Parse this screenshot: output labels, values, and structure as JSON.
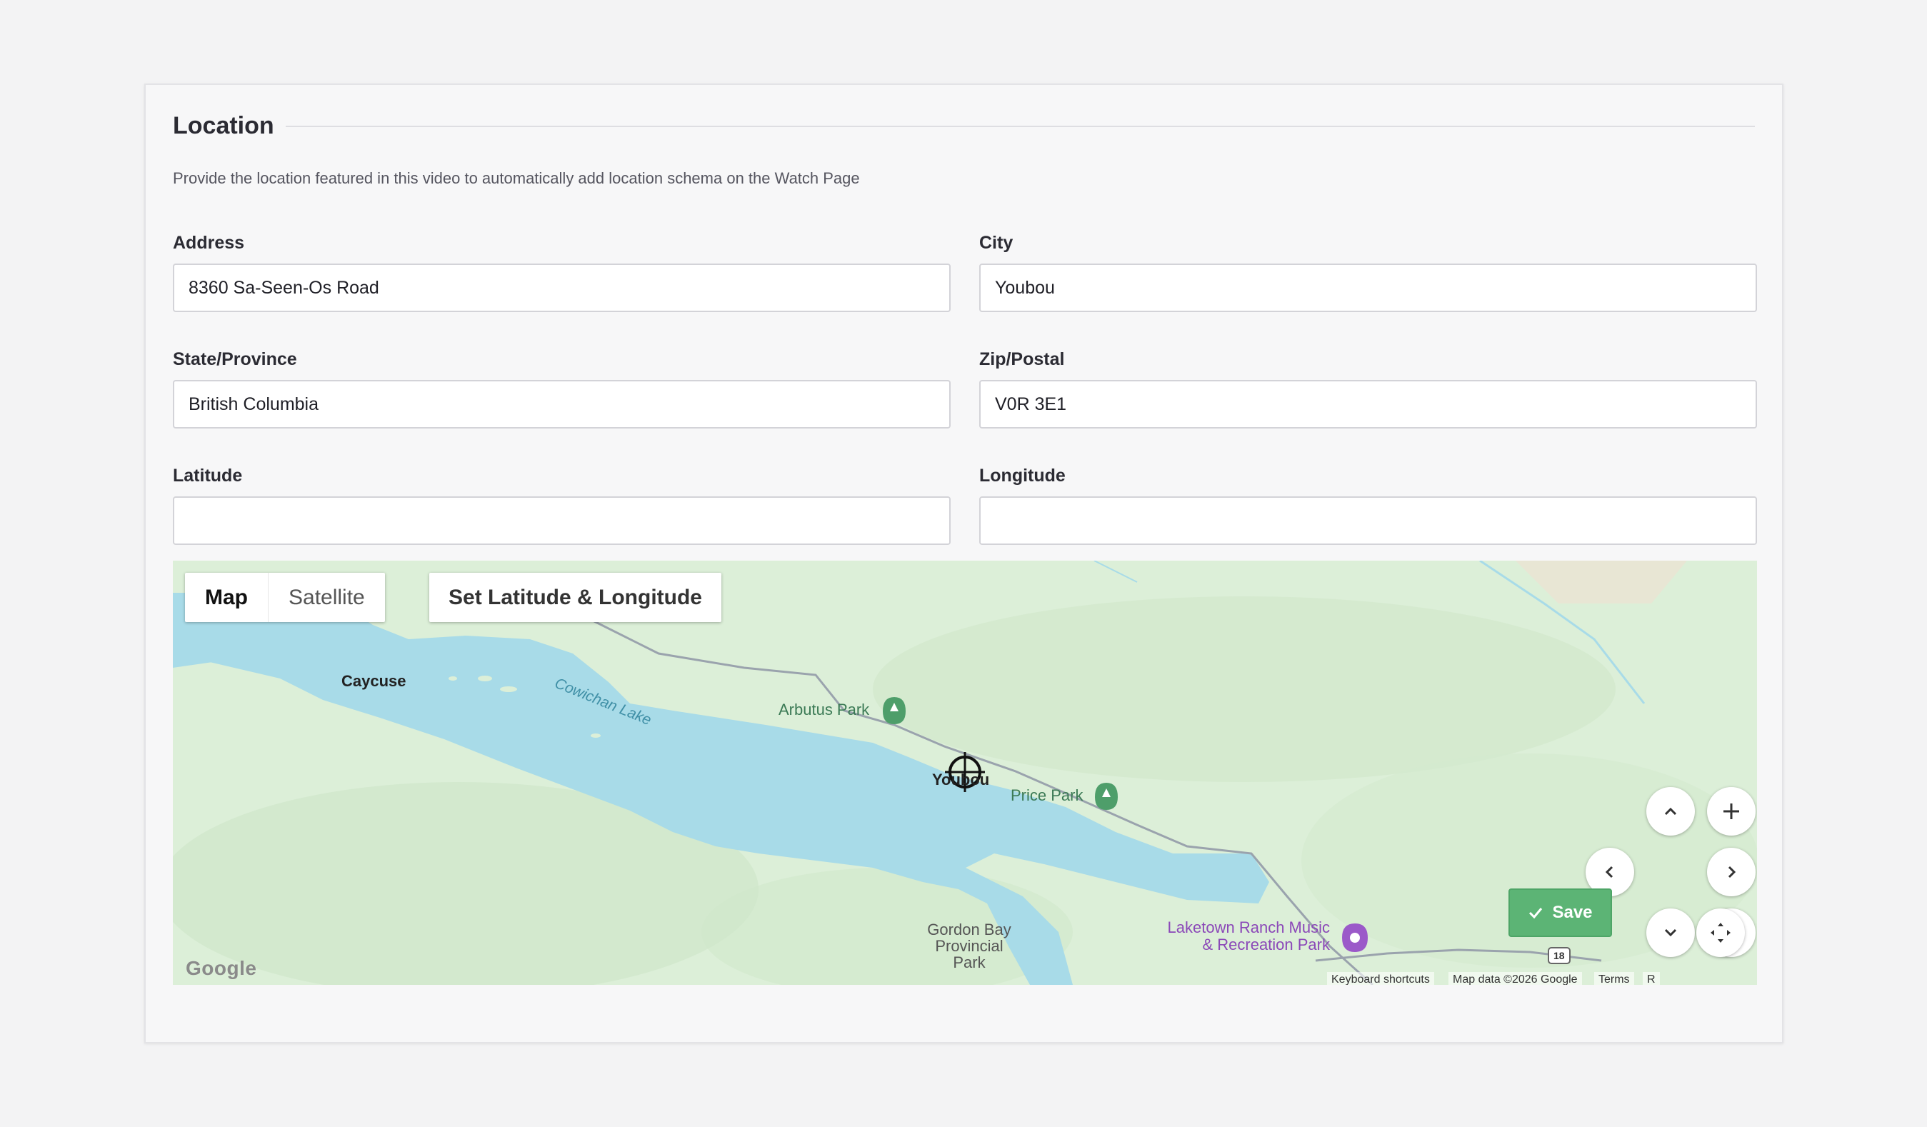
{
  "section": {
    "title": "Location",
    "description": "Provide the location featured in this video to automatically add location schema on the Watch Page"
  },
  "fields": {
    "address": {
      "label": "Address",
      "value": "8360 Sa-Seen-Os Road"
    },
    "city": {
      "label": "City",
      "value": "Youbou"
    },
    "state": {
      "label": "State/Province",
      "value": "British Columbia"
    },
    "zip": {
      "label": "Zip/Postal",
      "value": "V0R 3E1"
    },
    "latitude": {
      "label": "Latitude",
      "value": ""
    },
    "longitude": {
      "label": "Longitude",
      "value": ""
    }
  },
  "map": {
    "type_map": "Map",
    "type_satellite": "Satellite",
    "active_type": "Map",
    "set_latlng_label": "Set Latitude & Longitude",
    "places": {
      "caycuse": "Caycuse",
      "lake": "Cowichan Lake",
      "arbutus": "Arbutus Park",
      "youbou": "Youbou",
      "price": "Price Park",
      "gordon_1": "Gordon Bay",
      "gordon_2": "Provincial",
      "gordon_3": "Park",
      "laketown_1": "Laketown Ranch Music",
      "laketown_2": "& Recreation Park",
      "route": "18"
    },
    "google_logo": "Google",
    "attribution": {
      "shortcuts": "Keyboard shortcuts",
      "data": "Map data ©2026 Google",
      "terms": "Terms",
      "report": "R"
    },
    "colors": {
      "water": "#a8dbe8",
      "land": "#dcefd8",
      "park_pin": "#4e9e6a",
      "venue_pin": "#9b59c9"
    }
  },
  "actions": {
    "save_label": "Save"
  },
  "colors": {
    "save_bg": "#5cb475"
  }
}
